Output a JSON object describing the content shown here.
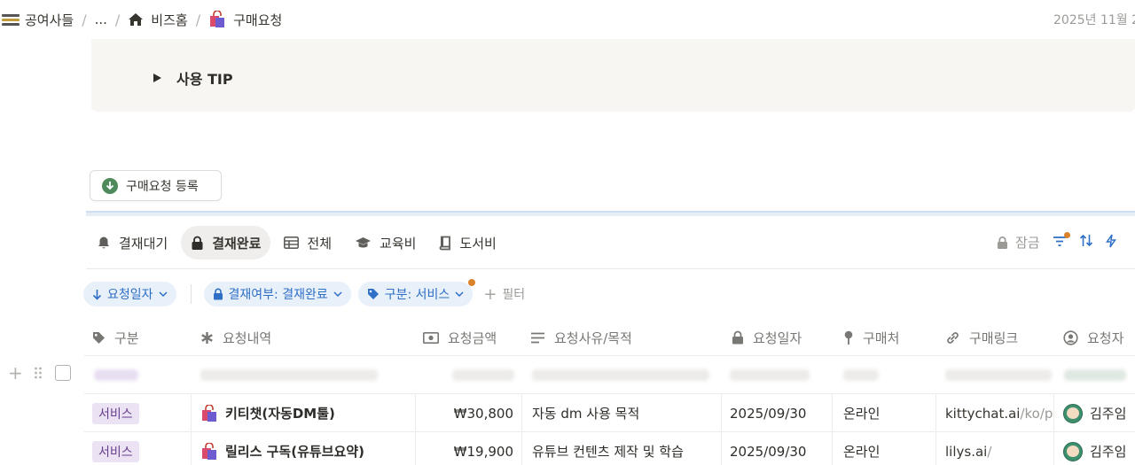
{
  "breadcrumb": {
    "workspace": "공여사들",
    "ellipsis": "...",
    "home": "비즈홈",
    "current": "구매요청"
  },
  "header": {
    "date": "2025년 11월 2"
  },
  "callout": {
    "tip_label": "사용 TIP"
  },
  "register_button": "구매요청 등록",
  "tabs": [
    {
      "label": "결재대기",
      "icon": "bell-icon"
    },
    {
      "label": "결재완료",
      "icon": "lock-icon",
      "active": true
    },
    {
      "label": "전체",
      "icon": "table-icon"
    },
    {
      "label": "교육비",
      "icon": "graduation-cap-icon"
    },
    {
      "label": "도서비",
      "icon": "book-icon"
    }
  ],
  "toolbar": {
    "lock_label": "잠금"
  },
  "filters": {
    "sort": "요청일자",
    "approval": "결재여부: 결재완료",
    "category": "구분: 서비스",
    "add_filter": "필터"
  },
  "columns": [
    "구분",
    "요청내역",
    "요청금액",
    "요청사유/목적",
    "요청일자",
    "구매처",
    "구매링크",
    "요청자"
  ],
  "rows": [
    {
      "category": "서비스",
      "item": "키티챗(자동DM툴)",
      "amount": "₩30,800",
      "reason": "자동 dm 사용 목적",
      "date": "2025/09/30",
      "vendor": "온라인",
      "link_main": "kittychat.ai",
      "link_rest": "/ko/pr",
      "requester": "김주임"
    },
    {
      "category": "서비스",
      "item": "릴리스 구독(유튜브요약)",
      "amount": "₩19,900",
      "reason": "유튜브 컨텐츠 제작 및 학습",
      "date": "2025/09/30",
      "vendor": "온라인",
      "link_main": "lilys.ai",
      "link_rest": "/",
      "requester": "김주임"
    }
  ],
  "colors": {
    "accent_blue": "#2f6fc6",
    "pill_bg": "#e8f0fa",
    "tag_bg": "#ebe3f3",
    "tag_text": "#6a3f8f",
    "notify_dot": "#d9822b",
    "register_icon": "#4f8a5d"
  }
}
